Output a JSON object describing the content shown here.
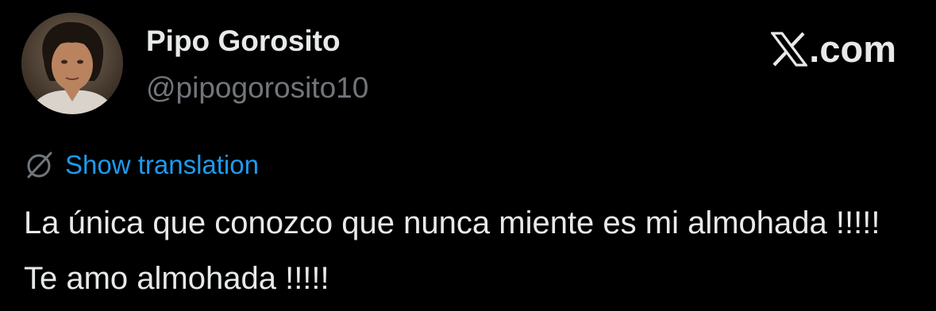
{
  "author": {
    "display_name": "Pipo Gorosito",
    "handle": "@pipogorosito10"
  },
  "brand": {
    "logo_icon": "x-logo-icon",
    "suffix": ".com"
  },
  "translation": {
    "icon": "globe-icon",
    "label": "Show translation"
  },
  "tweet": {
    "text": "La única que conozco que nunca miente es mi almohada !!!!! Te amo almohada !!!!!"
  },
  "colors": {
    "background": "#000000",
    "primary_text": "#e7e9ea",
    "secondary_text": "#71767b",
    "link": "#1d9bf0"
  }
}
